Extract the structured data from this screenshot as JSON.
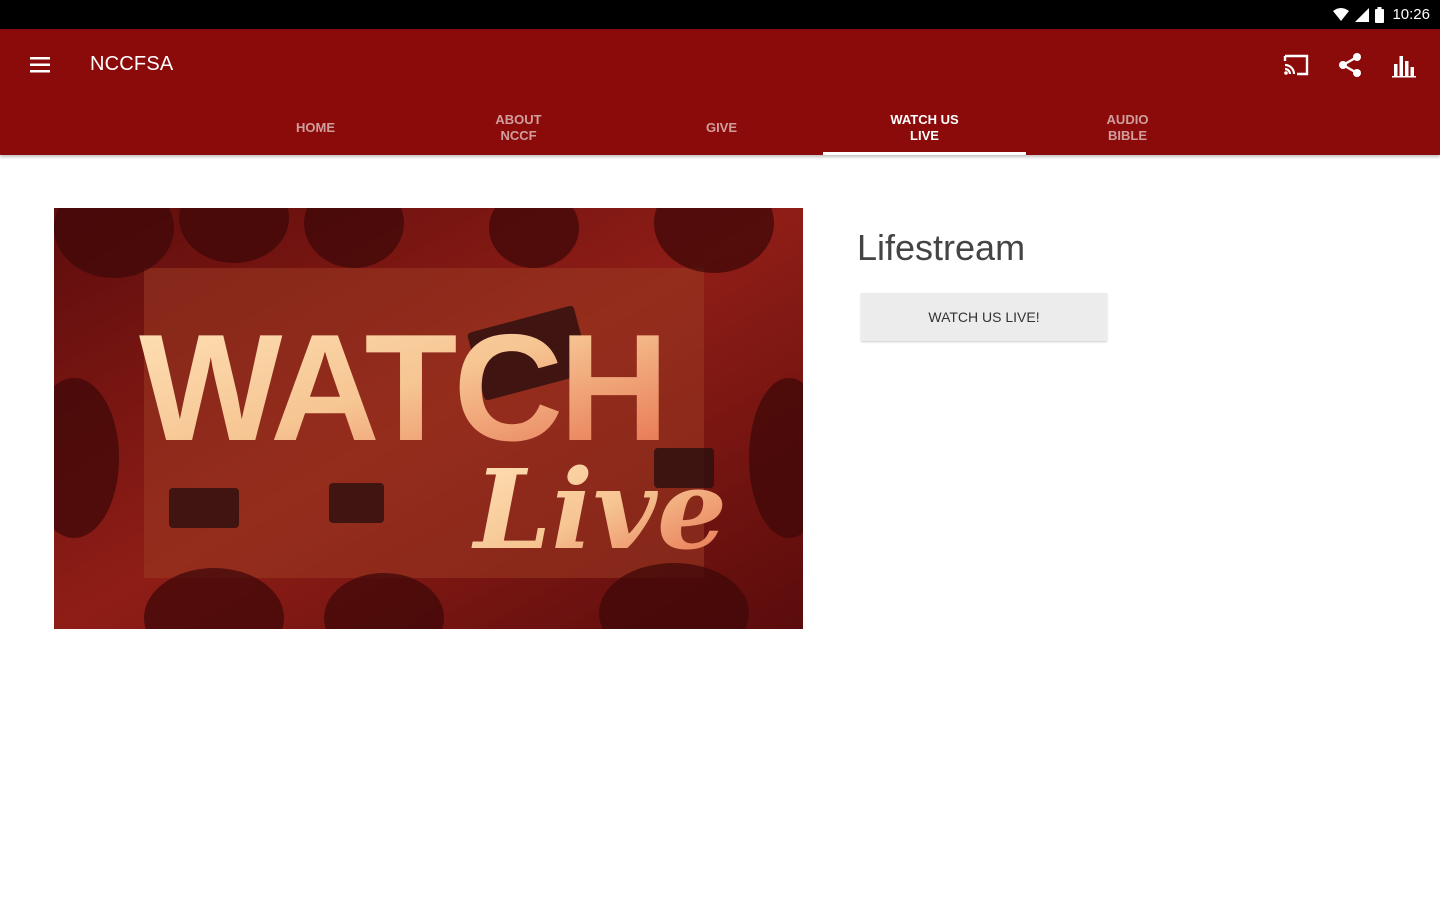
{
  "status_bar": {
    "time": "10:26",
    "icons": [
      "wifi-icon",
      "signal-icon",
      "battery-icon"
    ]
  },
  "app_bar": {
    "title": "NCCFSA",
    "menu_icon": "menu-icon",
    "actions": [
      "cast-icon",
      "share-icon",
      "bar-chart-icon"
    ],
    "background_color": "#8b0a0a"
  },
  "tabs": [
    {
      "label": "HOME",
      "active": false
    },
    {
      "label": "ABOUT NCCF",
      "active": false
    },
    {
      "label": "GIVE",
      "active": false
    },
    {
      "label": "WATCH US LIVE",
      "active": true
    },
    {
      "label": "AUDIO BIBLE",
      "active": false
    }
  ],
  "main": {
    "hero_image": {
      "headline": "WATCH",
      "script": "Live",
      "tint_color": "#8b1a1a"
    },
    "section_title": "Lifestream",
    "watch_button_label": "WATCH US LIVE!"
  }
}
